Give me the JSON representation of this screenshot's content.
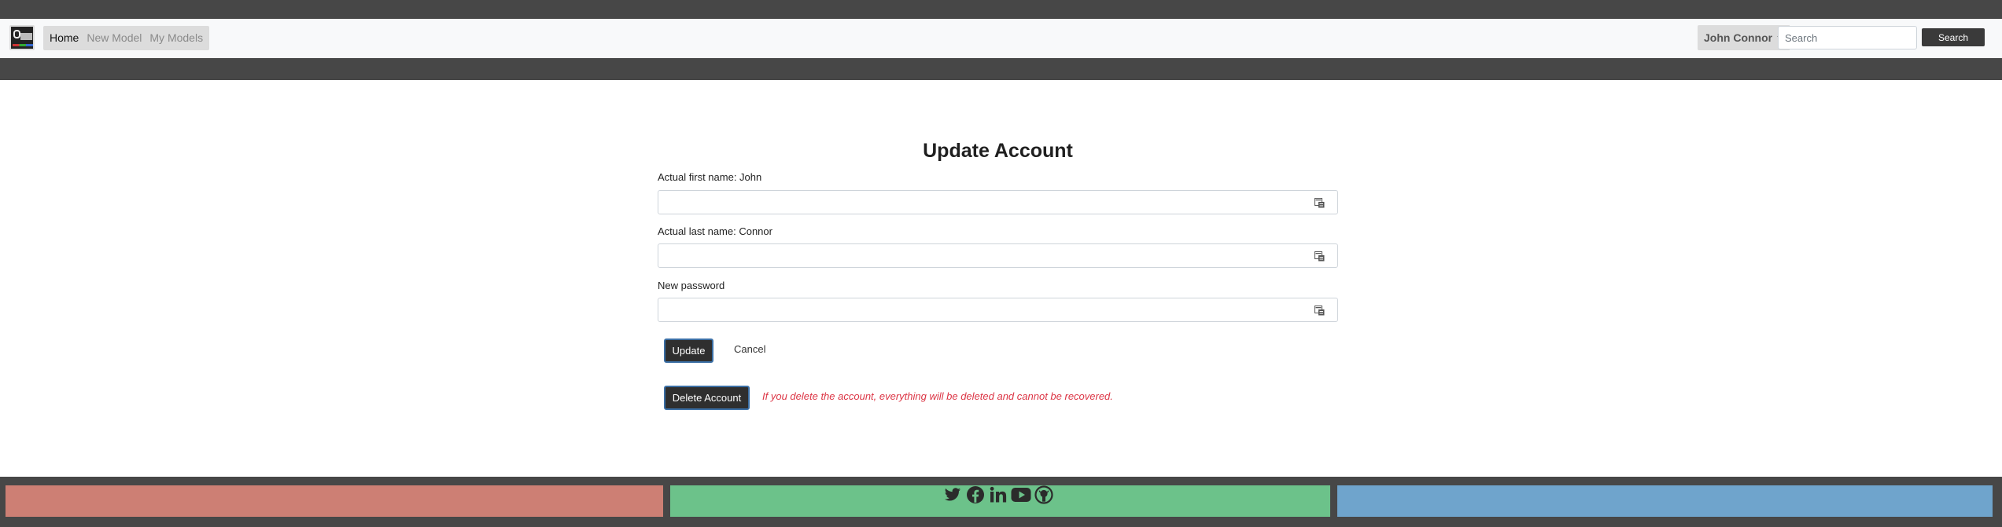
{
  "navbar": {
    "links": [
      {
        "label": "Home",
        "active": true
      },
      {
        "label": "New Model",
        "active": false
      },
      {
        "label": "My Models",
        "active": false
      }
    ],
    "user_name": "John Connor",
    "search_placeholder": "Search",
    "search_value": "",
    "search_button": "Search"
  },
  "form": {
    "title": "Update Account",
    "first_name_label": "Actual first name: John",
    "first_name_value": "",
    "last_name_label": "Actual last name: Connor",
    "last_name_value": "",
    "password_label": "New password",
    "password_value": "",
    "update_button": "Update",
    "cancel_link": "Cancel",
    "delete_button": "Delete Account",
    "delete_warning": "If you delete the account, everything will be deleted and cannot be recovered."
  },
  "footer": {
    "socials": [
      "twitter-icon",
      "facebook-icon",
      "linkedin-icon",
      "youtube-icon",
      "github-icon"
    ],
    "colors": {
      "left": "#cd7f74",
      "middle": "#6cc28a",
      "right": "#6fa4cc",
      "bar": "#474747"
    }
  },
  "colors": {
    "navbar_bg": "#f8f9fa",
    "band": "#474747",
    "primary_button": "#2f2f2f",
    "button_border": "#3b6fa5",
    "warning_text": "#dc3545"
  }
}
